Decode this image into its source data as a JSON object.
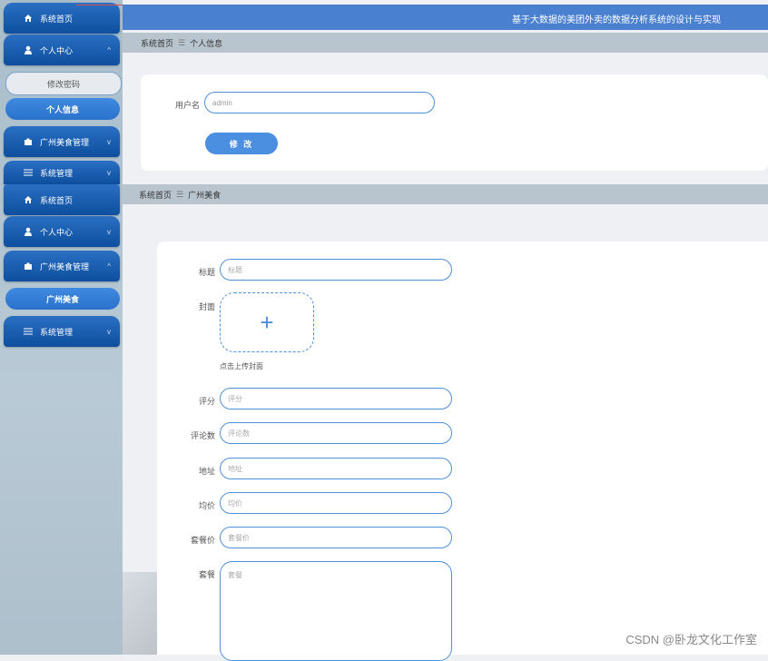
{
  "header": {
    "title": "基于大数据的美团外卖的数据分析系统的设计与实现"
  },
  "sidebar1": {
    "items": [
      {
        "label": "系统首页",
        "icon": "home-icon"
      },
      {
        "label": "个人中心",
        "icon": "user-icon",
        "chevron": "^"
      },
      {
        "label": "修改密码"
      },
      {
        "label": "个人信息"
      },
      {
        "label": "广州美食管理",
        "icon": "briefcase-icon",
        "chevron": "v"
      },
      {
        "label": "系统管理",
        "icon": "sliders-icon",
        "chevron": "v"
      }
    ]
  },
  "sidebar2": {
    "items": [
      {
        "label": "系统首页",
        "icon": "home-icon"
      },
      {
        "label": "个人中心",
        "icon": "user-icon",
        "chevron": "v"
      },
      {
        "label": "广州美食管理",
        "icon": "briefcase-icon",
        "chevron": "^"
      },
      {
        "label": "广州美食"
      },
      {
        "label": "系统管理",
        "icon": "sliders-icon",
        "chevron": "v"
      }
    ]
  },
  "breadcrumb1": {
    "home": "系统首页",
    "sep": "☰",
    "current": "个人信息"
  },
  "breadcrumb2": {
    "home": "系统首页",
    "sep": "☰",
    "current": "广州美食"
  },
  "profile_form": {
    "username_label": "用户名",
    "username_value": "admin",
    "submit_label": "修 改"
  },
  "food_form": {
    "title_label": "标题",
    "title_placeholder": "标题",
    "cover_label": "封面",
    "cover_hint": "点击上传封面",
    "rating_label": "评分",
    "rating_placeholder": "评分",
    "reviews_label": "评论数",
    "reviews_placeholder": "评论数",
    "address_label": "地址",
    "address_placeholder": "地址",
    "avg_price_label": "均价",
    "avg_price_placeholder": "均价",
    "set_price_label": "套餐价",
    "set_price_placeholder": "套餐价",
    "set_label": "套餐",
    "set_placeholder": "套餐"
  },
  "watermark": "CSDN @卧龙文化工作室"
}
